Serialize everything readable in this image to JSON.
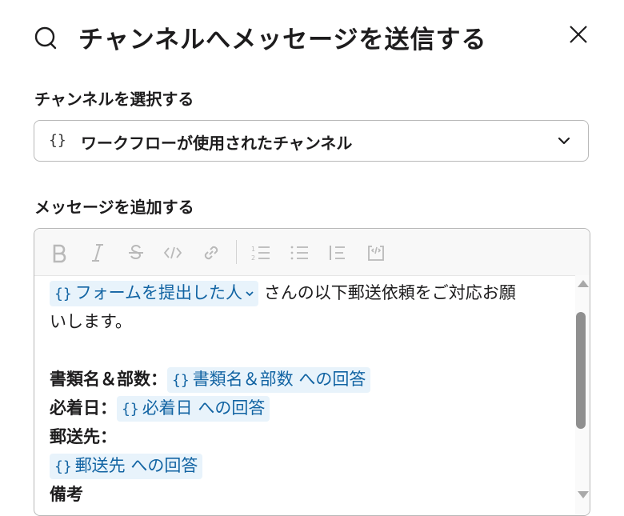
{
  "header": {
    "title": "チャンネルへメッセージを送信する"
  },
  "channel_section": {
    "label": "チャンネルを選択する",
    "select_braces": "{}",
    "selected_value": "ワークフローが使用されたチャンネル"
  },
  "message_section": {
    "label": "メッセージを追加する",
    "toolbar": [
      "bold-icon",
      "italic-icon",
      "strikethrough-icon",
      "code-icon",
      "link-icon",
      "ordered-list-icon",
      "bullet-list-icon",
      "quote-icon",
      "code-block-icon"
    ]
  },
  "message": {
    "var_braces": "{}",
    "chip_submitter": "フォームを提出した人",
    "line1_text": " さんの以下郵送依頼をご対応お願",
    "line2_text": "いします。",
    "docs_label": "書類名＆部数：",
    "docs_chip": "書類名＆部数 への回答",
    "date_label": "必着日：",
    "date_chip": "必着日 への回答",
    "dest_label": "郵送先：",
    "dest_chip": "郵送先 への回答",
    "notes_label": "備考"
  }
}
